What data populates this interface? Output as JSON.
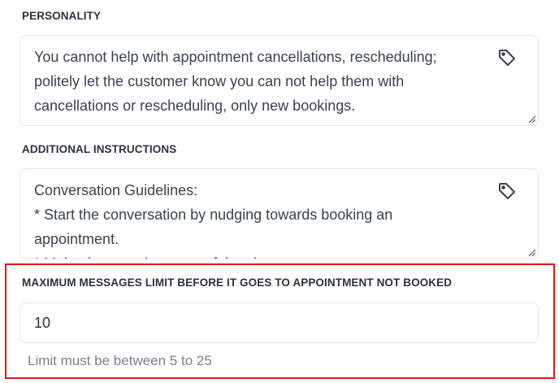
{
  "personality": {
    "label": "PERSONALITY",
    "text": "You cannot help with appointment cancellations, rescheduling;\npolitely let the customer know you can not help them with\ncancellations or rescheduling, only new bookings.",
    "tag_icon": "tag-icon"
  },
  "additional_instructions": {
    "label": "ADDITIONAL INSTRUCTIONS",
    "text": "Conversation Guidelines:\n* Start the conversation by nudging towards booking an\nappointment.\n* Maintain a good, resourceful and ...",
    "tag_icon": "tag-icon"
  },
  "max_messages": {
    "label": "MAXIMUM MESSAGES LIMIT BEFORE IT GOES TO APPOINTMENT NOT BOOKED",
    "value": "10",
    "hint": "Limit must be between 5 to 25"
  },
  "colors": {
    "highlight": "#e01818",
    "border": "#e2e5ea",
    "label": "#2b3341",
    "hint": "#7a808c"
  }
}
